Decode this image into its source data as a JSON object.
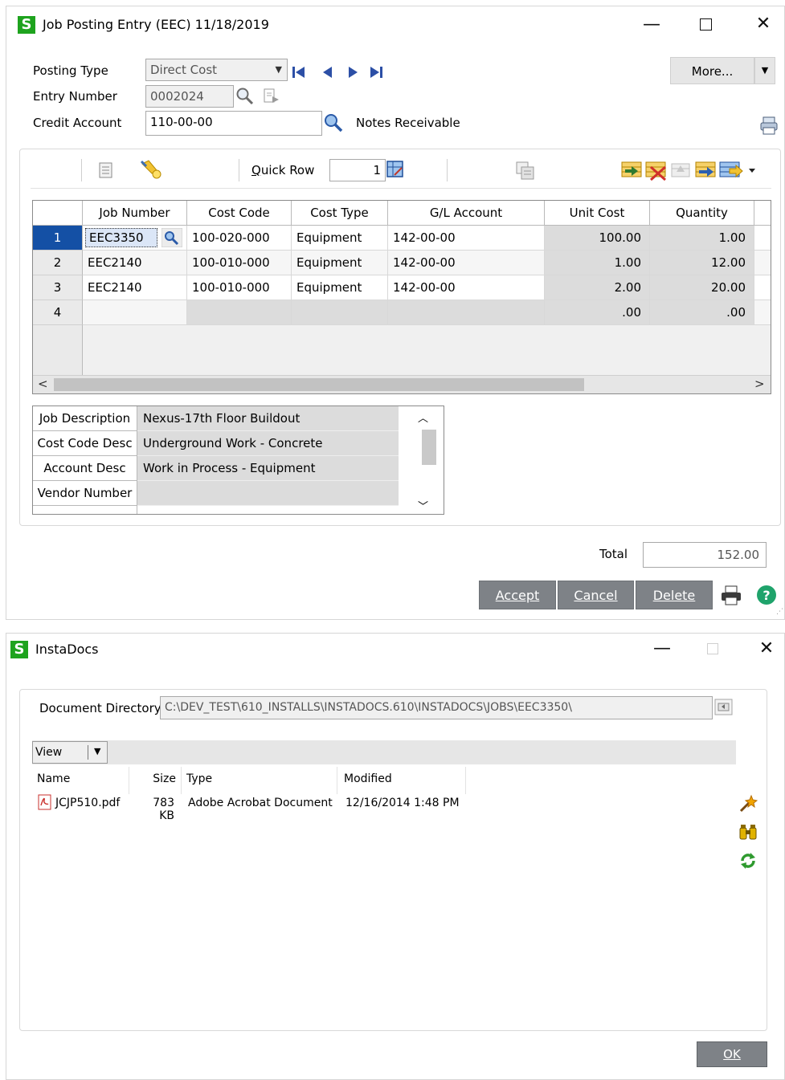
{
  "job_window": {
    "title": "Job Posting Entry (EEC) 11/18/2019",
    "posting_type_label": "Posting Type",
    "posting_type_value": "Direct Cost",
    "entry_number_label": "Entry Number",
    "entry_number_value": "0002024",
    "credit_account_label": "Credit Account",
    "credit_account_value": "110-00-00",
    "credit_account_desc": "Notes Receivable",
    "more_label": "More...",
    "quick_row_label": "Quick Row",
    "quick_row_value": "1",
    "grid": {
      "headers": [
        "Job Number",
        "Cost Code",
        "Cost Type",
        "G/L Account",
        "Unit Cost",
        "Quantity"
      ],
      "rows": [
        {
          "num": "1",
          "job": "EEC3350",
          "cost_code": "100-020-000",
          "cost_type": "Equipment",
          "gl": "142-00-00",
          "unit_cost": "100.00",
          "qty": "1.00"
        },
        {
          "num": "2",
          "job": "EEC2140",
          "cost_code": "100-010-000",
          "cost_type": "Equipment",
          "gl": "142-00-00",
          "unit_cost": "1.00",
          "qty": "12.00"
        },
        {
          "num": "3",
          "job": "EEC2140",
          "cost_code": "100-010-000",
          "cost_type": "Equipment",
          "gl": "142-00-00",
          "unit_cost": "2.00",
          "qty": "20.00"
        },
        {
          "num": "4",
          "job": "",
          "cost_code": "",
          "cost_type": "",
          "gl": "",
          "unit_cost": ".00",
          "qty": ".00"
        }
      ]
    },
    "info": [
      {
        "label": "Job Description",
        "value": "Nexus-17th Floor Buildout"
      },
      {
        "label": "Cost Code Desc",
        "value": "Underground Work - Concrete"
      },
      {
        "label": "Account Desc",
        "value": "Work in Process - Equipment"
      },
      {
        "label": "Vendor Number",
        "value": ""
      }
    ],
    "total_label": "Total",
    "total_value": "152.00",
    "accept_label": "Accept",
    "cancel_label": "Cancel",
    "delete_label": "Delete"
  },
  "instadocs_window": {
    "title": "InstaDocs",
    "doc_dir_label": "Document Directory",
    "doc_dir_value": "C:\\DEV_TEST\\610_INSTALLS\\INSTADOCS.610\\INSTADOCS\\JOBS\\EEC3350\\",
    "view_label": "View",
    "columns": [
      "Name",
      "Size",
      "Type",
      "Modified"
    ],
    "files": [
      {
        "name": "JCJP510.pdf",
        "size": "783 KB",
        "type": "Adobe Acrobat Document",
        "modified": "12/16/2014 1:48 PM"
      }
    ],
    "ok_label": "OK"
  },
  "colors": {
    "selected_row": "#1450a5",
    "sage_green": "#1ea31e",
    "button_dark": "#7e8287"
  }
}
